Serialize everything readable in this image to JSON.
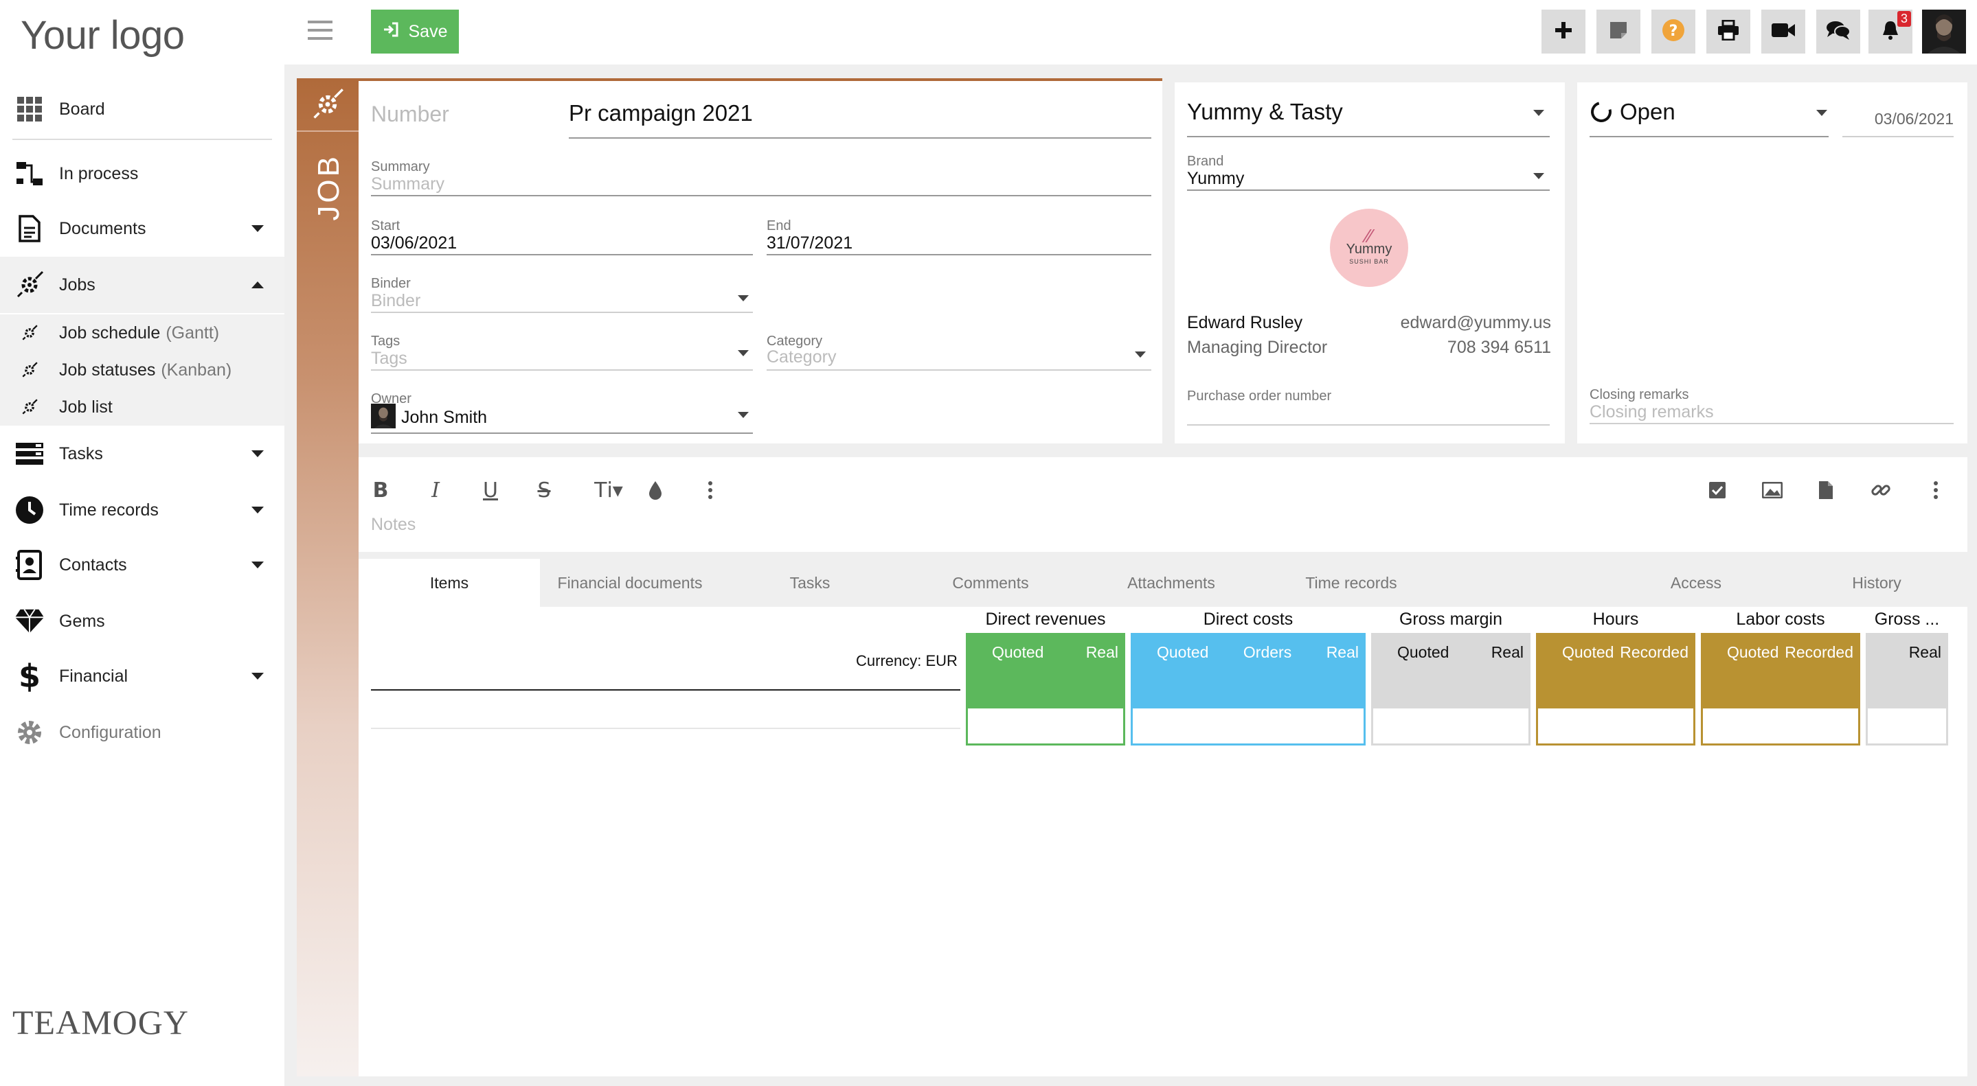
{
  "sidebar": {
    "logo": "Your logo",
    "items": [
      {
        "label": "Board"
      },
      {
        "label": "In process"
      },
      {
        "label": "Documents"
      },
      {
        "label": "Jobs"
      },
      {
        "label": "Tasks"
      },
      {
        "label": "Time records"
      },
      {
        "label": "Contacts"
      },
      {
        "label": "Gems"
      },
      {
        "label": "Financial"
      },
      {
        "label": "Configuration"
      }
    ],
    "jobs_sub": [
      {
        "label": "Job schedule",
        "hint": "(Gantt)"
      },
      {
        "label": "Job statuses",
        "hint": "(Kanban)"
      },
      {
        "label": "Job list",
        "hint": ""
      }
    ],
    "brand": "TEAMOGY"
  },
  "topbar": {
    "save_label": "Save",
    "notifications_count": "3"
  },
  "job": {
    "strip_label": "JOB",
    "number_placeholder": "Number",
    "title": "Pr campaign 2021",
    "summary_label": "Summary",
    "summary_placeholder": "Summary",
    "start_label": "Start",
    "start_value": "03/06/2021",
    "end_label": "End",
    "end_value": "31/07/2021",
    "binder_label": "Binder",
    "binder_placeholder": "Binder",
    "tags_label": "Tags",
    "tags_placeholder": "Tags",
    "category_label": "Category",
    "category_placeholder": "Category",
    "owner_label": "Owner",
    "owner_value": "John Smith"
  },
  "client": {
    "name": "Yummy & Tasty",
    "brand_label": "Brand",
    "brand_value": "Yummy",
    "logo_text": "Yummy",
    "logo_sub": "SUSHI BAR",
    "contact_name": "Edward Rusley",
    "contact_email": "edward@yummy.us",
    "contact_role": "Managing Director",
    "contact_phone": "708 394 6511",
    "po_label": "Purchase order number"
  },
  "status": {
    "value": "Open",
    "date": "03/06/2021",
    "closing_label": "Closing remarks",
    "closing_placeholder": "Closing remarks"
  },
  "notes": {
    "placeholder": "Notes"
  },
  "tabs": [
    {
      "label": "Items"
    },
    {
      "label": "Financial documents"
    },
    {
      "label": "Tasks"
    },
    {
      "label": "Comments"
    },
    {
      "label": "Attachments"
    },
    {
      "label": "Time records"
    },
    {
      "label": "Access"
    },
    {
      "label": "History"
    }
  ],
  "items_table": {
    "currency": "Currency: EUR",
    "groups": [
      {
        "title": "Direct revenues",
        "cols": [
          "Quoted",
          "Real"
        ]
      },
      {
        "title": "Direct costs",
        "cols": [
          "Quoted",
          "Orders",
          "Real"
        ]
      },
      {
        "title": "Gross margin",
        "cols": [
          "Quoted",
          "Real"
        ]
      },
      {
        "title": "Hours",
        "cols": [
          "Quoted",
          "Recorded"
        ]
      },
      {
        "title": "Labor costs",
        "cols": [
          "Quoted",
          "Recorded"
        ]
      },
      {
        "title": "Gross ...",
        "cols": [
          "Real"
        ]
      }
    ]
  },
  "colors": {
    "accent": "#b06a3a",
    "save": "#5cb85c",
    "revenues": "#5cb85c",
    "costs": "#56bfee",
    "margin": "#d9d9d9",
    "hours": "#b99232"
  }
}
